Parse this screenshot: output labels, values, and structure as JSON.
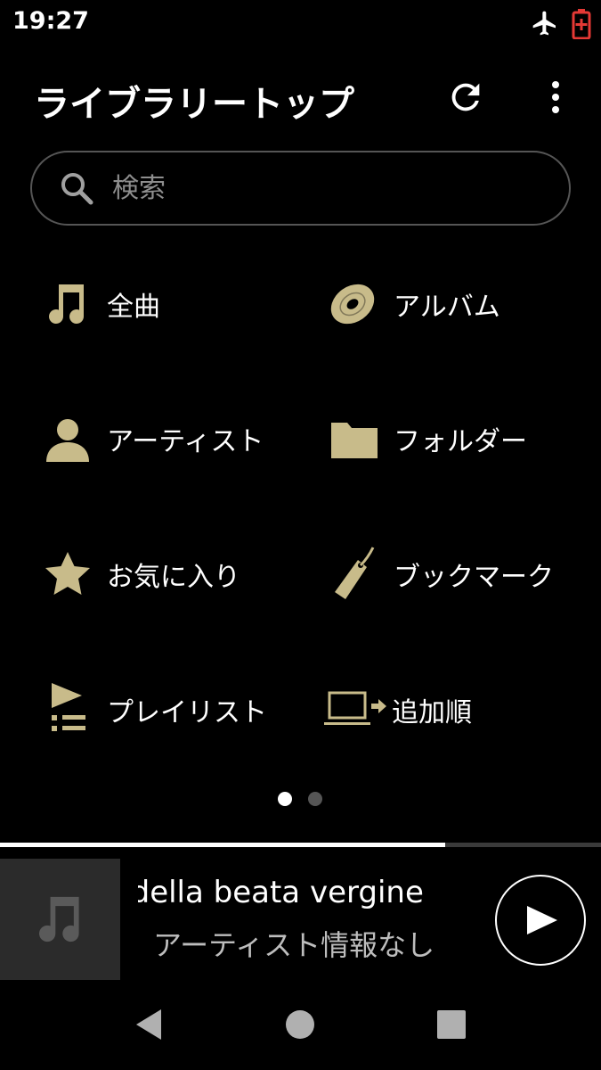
{
  "status_bar": {
    "time": "19:27",
    "icons": [
      "airplane-icon",
      "battery-icon"
    ],
    "battery_color": "#e53935"
  },
  "header": {
    "title": "ライブラリートップ",
    "actions": [
      "refresh-icon",
      "more-vert-icon"
    ]
  },
  "search": {
    "placeholder": "検索",
    "icon": "search-icon"
  },
  "theme": {
    "accent": "#c8bb8a",
    "background": "#000000"
  },
  "menu": [
    {
      "label": "全曲",
      "icon": "music-note-icon"
    },
    {
      "label": "アルバム",
      "icon": "disc-icon"
    },
    {
      "label": "アーティスト",
      "icon": "person-icon"
    },
    {
      "label": "フォルダー",
      "icon": "folder-icon"
    },
    {
      "label": "お気に入り",
      "icon": "star-icon"
    },
    {
      "label": "ブックマーク",
      "icon": "tag-icon"
    },
    {
      "label": "プレイリスト",
      "icon": "playlist-icon"
    },
    {
      "label": "追加順",
      "icon": "laptop-import-icon"
    }
  ],
  "pager": {
    "pages": 2,
    "current": 1
  },
  "playback": {
    "progress": 0.74
  },
  "now_playing": {
    "title": "o della beata vergine",
    "artist": "アーティスト情報なし",
    "art_icon": "music-note-icon",
    "action_icon": "play-icon"
  },
  "navigation": {
    "buttons": [
      "back-icon",
      "home-icon",
      "recents-icon"
    ]
  }
}
